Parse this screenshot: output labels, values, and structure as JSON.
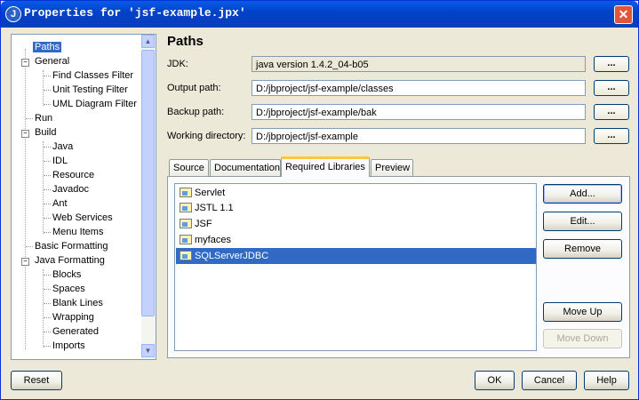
{
  "window": {
    "title": "Properties for 'jsf-example.jpx'",
    "app_icon": "J",
    "close_icon": "✕"
  },
  "tree": {
    "items": [
      {
        "label": "Paths",
        "selected": true
      },
      {
        "label": "General"
      },
      {
        "label": "Find Classes Filter"
      },
      {
        "label": "Unit Testing Filter"
      },
      {
        "label": "UML Diagram Filter"
      },
      {
        "label": "Run"
      },
      {
        "label": "Build"
      },
      {
        "label": "Java"
      },
      {
        "label": "IDL"
      },
      {
        "label": "Resource"
      },
      {
        "label": "Javadoc"
      },
      {
        "label": "Ant"
      },
      {
        "label": "Web Services"
      },
      {
        "label": "Menu Items"
      },
      {
        "label": "Basic Formatting"
      },
      {
        "label": "Java Formatting"
      },
      {
        "label": "Blocks"
      },
      {
        "label": "Spaces"
      },
      {
        "label": "Blank Lines"
      },
      {
        "label": "Wrapping"
      },
      {
        "label": "Generated"
      },
      {
        "label": "Imports"
      }
    ]
  },
  "paths": {
    "title": "Paths",
    "jdk_label": "JDK:",
    "jdk_value": "java version 1.4.2_04-b05",
    "output_label": "Output path:",
    "output_value": "D:/jbproject/jsf-example/classes",
    "backup_label": "Backup path:",
    "backup_value": "D:/jbproject/jsf-example/bak",
    "working_label": "Working directory:",
    "working_value": "D:/jbproject/jsf-example",
    "browse_label": "..."
  },
  "tabs": {
    "source": "Source",
    "documentation": "Documentation",
    "required_libraries": "Required Libraries",
    "preview": "Preview"
  },
  "libraries": [
    "Servlet",
    "JSTL 1.1",
    "JSF",
    "myfaces",
    "SQLServerJDBC"
  ],
  "lib_buttons": {
    "add": "Add...",
    "edit": "Edit...",
    "remove": "Remove",
    "move_up": "Move Up",
    "move_down": "Move Down"
  },
  "footer": {
    "reset": "Reset",
    "ok": "OK",
    "cancel": "Cancel",
    "help": "Help"
  }
}
